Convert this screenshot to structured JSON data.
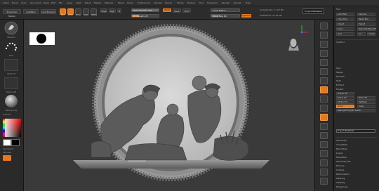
{
  "menu": [
    "Alpha",
    "Brush",
    "Color",
    "Document",
    "Draw",
    "Edit",
    "File",
    "Layer",
    "Light",
    "Macro",
    "Marker",
    "Material",
    "Movie",
    "Picker",
    "Preferences",
    "Render",
    "Stencil",
    "Stroke",
    "Texture",
    "Tool",
    "Transform",
    "Zplugin",
    "Zscript",
    "Help"
  ],
  "top": {
    "projection_master": "Projection Master",
    "lightbox": "LightBox",
    "live_boolean": "Live Boolean",
    "edit": "Edit",
    "draw": "Draw",
    "move": "Move",
    "scale": "Scale",
    "rotate": "Rotate",
    "mrgb": "Mrgb",
    "rgb": "Rgb",
    "m": "M",
    "zadd": "Zadd",
    "zsub": "Zsub",
    "zcut": "Zcut",
    "rgb_intensity": "Rgb Intensity 100",
    "z_intensity": "Z Intensity 25",
    "focal_shift": "Focal Shift 0",
    "draw_size": "Draw Size 64",
    "dynamic": "Dynamic",
    "active_points": "ActivePoints: 3.102 Mil",
    "total_points": "TotalPoints: 3.102 Mil",
    "project_bas_relief": "Project BasRelief",
    "rgb_fill": 1.0,
    "z_fill": 0.25
  },
  "left": {
    "standard": "Standard",
    "dots": "Dots",
    "alpha_off": "Alpha Off",
    "texture_off": "Texture Off",
    "matcap": "MatCap Gray",
    "gradient": "Gradient",
    "switch_color": "SwitchColor",
    "alternate": "Alternate"
  },
  "tray": {
    "title": "Tool",
    "items": [
      "Load Tool",
      "Save As",
      "Copy Tool",
      "Paste Tool",
      "Import",
      "Export",
      "Clone",
      "Make PolyMesh3D",
      "GoZ",
      "All",
      "Visible",
      "R"
    ],
    "subtools_label": "SubTool",
    "props": [
      "Spix",
      "Merge",
      "Remesh",
      "Split",
      "Extract",
      "Project",
      "Project All",
      "Dist 0.02",
      "Mean 25",
      "PA Blur 10",
      "Farthest",
      "Outer",
      "Inner",
      "Reproject Higher Subdiv",
      "Project BasRelief"
    ],
    "orange_item": "Geometry",
    "sections": [
      "Geometry",
      "ArrayMesh",
      "NanoMesh",
      "Layers",
      "FiberMesh",
      "Geometry HD",
      "Preview",
      "Surface",
      "Deformation",
      "Masking",
      "Visibility",
      "Polygroups"
    ]
  },
  "colors": {
    "orange": "#e8781c",
    "panel": "#2a2a2a",
    "canvas": "#3a3a3a"
  }
}
